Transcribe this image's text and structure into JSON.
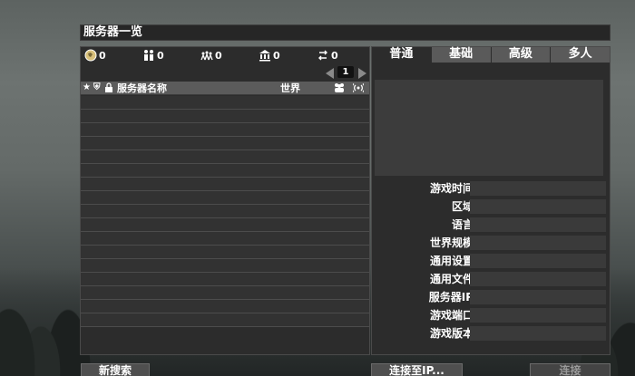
{
  "title": "服务器一览",
  "filters": [
    {
      "icon": "globe-icon",
      "value": "0"
    },
    {
      "icon": "players-icon",
      "value": "0"
    },
    {
      "icon": "group-icon",
      "value": "0"
    },
    {
      "icon": "museum-icon",
      "value": "0"
    },
    {
      "icon": "swap-icon",
      "value": "0"
    }
  ],
  "pager": {
    "page": "1"
  },
  "list_header": {
    "icons": [
      "star-icon",
      "shield-icon",
      "lock-icon"
    ],
    "name": "服务器名称",
    "world": "世界",
    "players_icon": "people-icon",
    "ping_icon": "signal-icon"
  },
  "row_count": 17,
  "tabs": [
    "普通",
    "基础",
    "高级",
    "多人"
  ],
  "active_tab": 0,
  "info_labels": [
    "游戏时间",
    "区域",
    "语言",
    "世界规模",
    "通用设置",
    "通用文件",
    "服务器IP",
    "游戏端口",
    "游戏版本"
  ],
  "buttons": {
    "new_search": "新搜索",
    "connect_ip": "连接至IP...",
    "connect": "连接"
  }
}
